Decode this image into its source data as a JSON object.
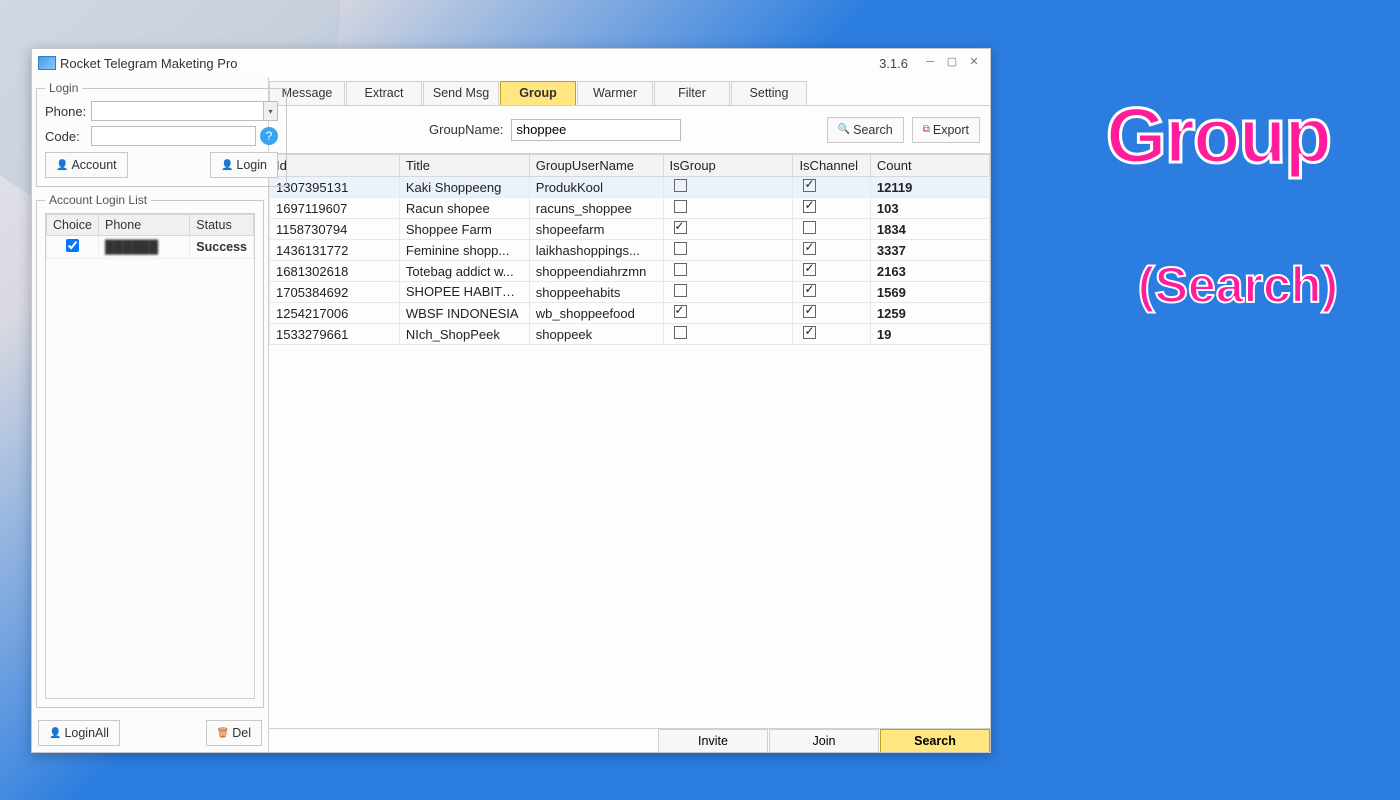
{
  "titlebar": {
    "title": "Rocket Telegram Maketing Pro",
    "version": "3.1.6"
  },
  "login": {
    "legend": "Login",
    "phone_label": "Phone:",
    "code_label": "Code:",
    "account_btn": "Account",
    "login_btn": "Login"
  },
  "acct": {
    "legend": "Account Login List",
    "headers": {
      "choice": "Choice",
      "phone": "Phone",
      "status": "Status"
    },
    "row": {
      "status": "Success"
    },
    "loginall_btn": "LoginAll",
    "del_btn": "Del"
  },
  "tabs": [
    "Message",
    "Extract",
    "Send Msg",
    "Group",
    "Warmer",
    "Filter",
    "Setting"
  ],
  "active_tab": "Group",
  "toolbar": {
    "groupname_label": "GroupName:",
    "groupname_value": "shoppee",
    "search_btn": "Search",
    "export_btn": "Export"
  },
  "grid": {
    "headers": {
      "id": "Id",
      "title": "Title",
      "user": "GroupUserName",
      "isgroup": "IsGroup",
      "ischannel": "IsChannel",
      "count": "Count"
    },
    "rows": [
      {
        "id": "1307395131",
        "title": "Kaki Shoppeeng",
        "user": "ProdukKool",
        "isgroup": false,
        "ischannel": true,
        "count": "12119"
      },
      {
        "id": "1697119607",
        "title": "Racun shopee",
        "user": "racuns_shoppee",
        "isgroup": false,
        "ischannel": true,
        "count": "103"
      },
      {
        "id": "1158730794",
        "title": "Shoppee Farm",
        "user": "shopeefarm",
        "isgroup": true,
        "ischannel": false,
        "count": "1834"
      },
      {
        "id": "1436131772",
        "title": "Feminine shopp...",
        "user": "laikhashoppings...",
        "isgroup": false,
        "ischannel": true,
        "count": "3337"
      },
      {
        "id": "1681302618",
        "title": "Totebag addict w...",
        "user": "shoppeendiahrzmn",
        "isgroup": false,
        "ischannel": true,
        "count": "2163"
      },
      {
        "id": "1705384692",
        "title": "SHOPEE HABITS 🛍️...",
        "user": "shoppeehabits",
        "isgroup": false,
        "ischannel": true,
        "count": "1569"
      },
      {
        "id": "1254217006",
        "title": "WBSF INDONESIA",
        "user": "wb_shoppeefood",
        "isgroup": true,
        "ischannel": true,
        "count": "1259"
      },
      {
        "id": "1533279661",
        "title": "NIch_ShopPeek",
        "user": "shoppeek",
        "isgroup": false,
        "ischannel": true,
        "count": "19"
      }
    ]
  },
  "footer_tabs": [
    "Invite",
    "Join",
    "Search"
  ],
  "active_footer": "Search",
  "decor": {
    "title": "Group",
    "sub": "(Search)"
  }
}
